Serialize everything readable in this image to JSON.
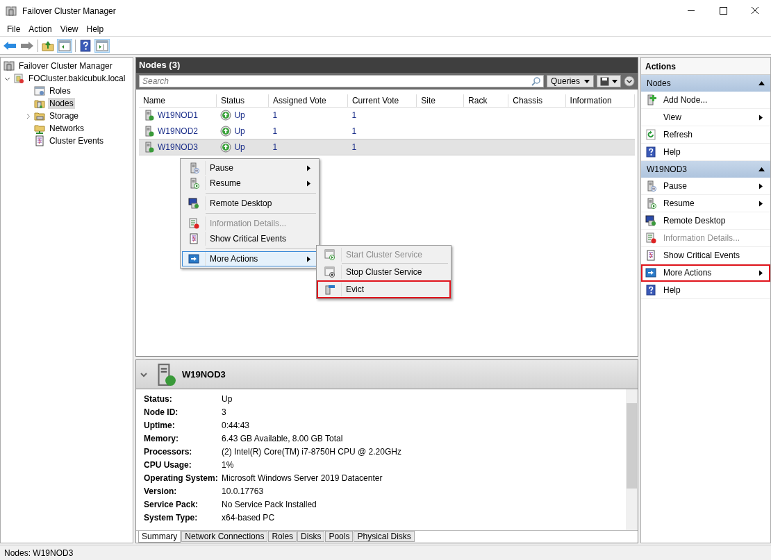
{
  "window": {
    "title": "Failover Cluster Manager"
  },
  "menu_bar": [
    "File",
    "Action",
    "View",
    "Help"
  ],
  "tree": [
    {
      "label": "Failover Cluster Manager",
      "kind": "manager",
      "selected": false,
      "children": [
        {
          "label": "FOCluster.bakicubuk.local",
          "kind": "cluster",
          "selected": false,
          "expanded": true,
          "children": [
            {
              "label": "Roles",
              "kind": "roles",
              "selected": false,
              "expandable": false
            },
            {
              "label": "Nodes",
              "kind": "nodes",
              "selected": true,
              "expandable": false
            },
            {
              "label": "Storage",
              "kind": "storage",
              "selected": false,
              "expandable": true
            },
            {
              "label": "Networks",
              "kind": "networks",
              "selected": false,
              "expandable": false
            },
            {
              "label": "Cluster Events",
              "kind": "events",
              "selected": false,
              "expandable": false
            }
          ]
        }
      ]
    }
  ],
  "nodes_panel": {
    "title": "Nodes (3)",
    "search": {
      "placeholder": "Search"
    },
    "queries_button": "Queries",
    "table": {
      "columns": [
        "Name",
        "Status",
        "Assigned Vote",
        "Current Vote",
        "Site",
        "Rack",
        "Chassis",
        "Information"
      ],
      "rows": [
        {
          "name": "W19NOD1",
          "status": "Up",
          "assigned_vote": "1",
          "current_vote": "1",
          "selected": false
        },
        {
          "name": "W19NOD2",
          "status": "Up",
          "assigned_vote": "1",
          "current_vote": "1",
          "selected": false
        },
        {
          "name": "W19NOD3",
          "status": "Up",
          "assigned_vote": "1",
          "current_vote": "1",
          "selected": true
        }
      ]
    }
  },
  "context_menu": {
    "groups": [
      [
        {
          "label": "Pause",
          "kind": "pause",
          "submenu": true,
          "disabled": false,
          "highlighted": false
        },
        {
          "label": "Resume",
          "kind": "resume",
          "submenu": true,
          "disabled": false,
          "highlighted": false
        }
      ],
      [
        {
          "label": "Remote Desktop",
          "kind": "remote-desktop",
          "submenu": false,
          "disabled": false,
          "highlighted": false
        }
      ],
      [
        {
          "label": "Information Details...",
          "kind": "info",
          "submenu": false,
          "disabled": true,
          "highlighted": false
        },
        {
          "label": "Show Critical Events",
          "kind": "events",
          "submenu": false,
          "disabled": false,
          "highlighted": false
        }
      ],
      [
        {
          "label": "More Actions",
          "kind": "more",
          "submenu": true,
          "disabled": false,
          "highlighted": true
        }
      ]
    ],
    "submenu": [
      {
        "label": "Start Cluster Service",
        "kind": "start",
        "disabled": true,
        "outlined": false
      },
      {
        "label": "Stop Cluster Service",
        "kind": "stop",
        "disabled": false,
        "outlined": false
      },
      {
        "label": "Evict",
        "kind": "evict",
        "disabled": false,
        "outlined": true
      }
    ]
  },
  "details": {
    "title": "W19NOD3",
    "fields": [
      {
        "label": "Status:",
        "value": "Up"
      },
      {
        "label": "Node ID:",
        "value": "3"
      },
      {
        "label": "Uptime:",
        "value": "0:44:43"
      },
      {
        "label": "Memory:",
        "value": "6.43 GB Available, 8.00 GB Total"
      },
      {
        "label": "Processors:",
        "value": "(2) Intel(R) Core(TM) i7-8750H CPU @ 2.20GHz"
      },
      {
        "label": "CPU Usage:",
        "value": "1%"
      },
      {
        "label": "Operating System:",
        "value": "Microsoft Windows Server 2019 Datacenter"
      },
      {
        "label": "Version:",
        "value": "10.0.17763"
      },
      {
        "label": "Service Pack:",
        "value": "No Service Pack Installed"
      },
      {
        "label": "System Type:",
        "value": "x64-based PC"
      }
    ],
    "tabs": [
      {
        "label": "Summary",
        "selected": true
      },
      {
        "label": "Network Connections",
        "selected": false
      },
      {
        "label": "Roles",
        "selected": false
      },
      {
        "label": "Disks",
        "selected": false
      },
      {
        "label": "Pools",
        "selected": false
      },
      {
        "label": "Physical Disks",
        "selected": false
      }
    ]
  },
  "actions": {
    "title": "Actions",
    "sections": [
      {
        "title": "Nodes",
        "items": [
          {
            "label": "Add Node...",
            "kind": "add",
            "submenu": false,
            "disabled": false,
            "outlined": false
          },
          {
            "label": "View",
            "kind": "none",
            "submenu": true,
            "disabled": false,
            "outlined": false
          },
          {
            "label": "Refresh",
            "kind": "refresh",
            "submenu": false,
            "disabled": false,
            "outlined": false
          },
          {
            "label": "Help",
            "kind": "help",
            "submenu": false,
            "disabled": false,
            "outlined": false
          }
        ]
      },
      {
        "title": "W19NOD3",
        "items": [
          {
            "label": "Pause",
            "kind": "pause",
            "submenu": true,
            "disabled": false,
            "outlined": false
          },
          {
            "label": "Resume",
            "kind": "resume",
            "submenu": true,
            "disabled": false,
            "outlined": false
          },
          {
            "label": "Remote Desktop",
            "kind": "remote-desktop",
            "submenu": false,
            "disabled": false,
            "outlined": false
          },
          {
            "label": "Information Details...",
            "kind": "info",
            "submenu": false,
            "disabled": true,
            "outlined": false
          },
          {
            "label": "Show Critical Events",
            "kind": "events",
            "submenu": false,
            "disabled": false,
            "outlined": false
          },
          {
            "label": "More Actions",
            "kind": "more",
            "submenu": true,
            "disabled": false,
            "outlined": true
          },
          {
            "label": "Help",
            "kind": "help",
            "submenu": false,
            "disabled": false,
            "outlined": false
          }
        ]
      }
    ]
  },
  "status_bar": "Nodes: W19NOD3"
}
